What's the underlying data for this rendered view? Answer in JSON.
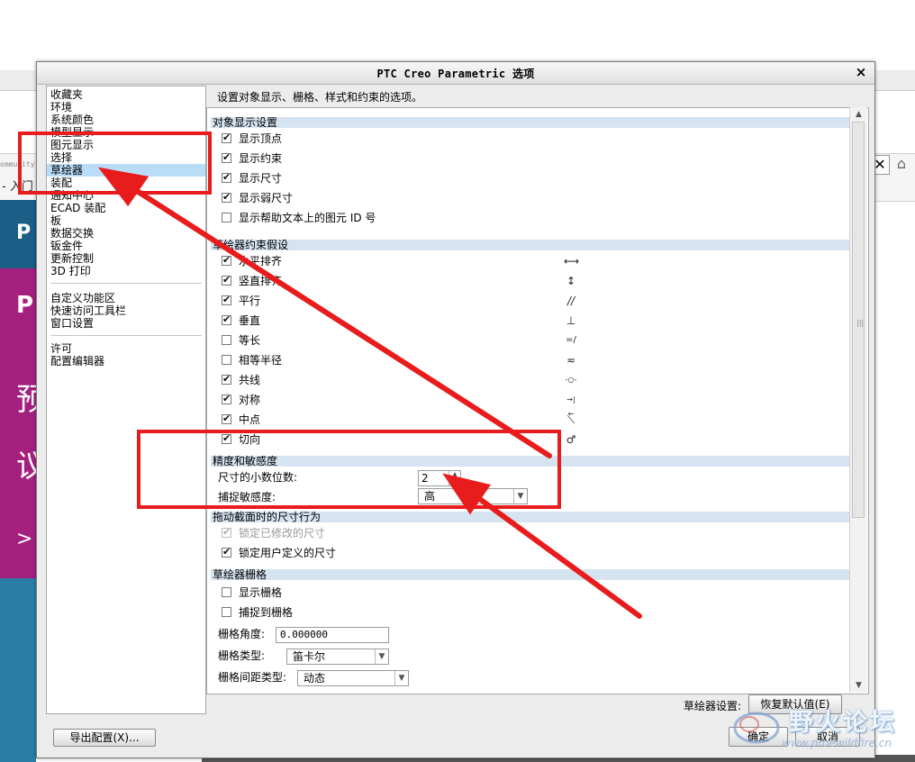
{
  "background": {
    "url_fragment": "ommunity",
    "breadcrumb": "- 入门",
    "banner_glyphs": [
      "P",
      "P",
      "预",
      "议",
      ">"
    ],
    "colors": {
      "banner": "#a4207f",
      "banner_top": "#1b5f86"
    }
  },
  "dialog": {
    "title": "PTC Creo Parametric 选项",
    "close_symbol": "×",
    "description": "设置对象显示、栅格、样式和约束的选项。",
    "nav": {
      "group1": [
        "收藏夹",
        "环境",
        "系统颜色",
        "模型显示",
        "图元显示",
        "选择",
        "草绘器",
        "装配",
        "通知中心",
        "ECAD 装配",
        "板",
        "数据交换",
        "钣金件",
        "更新控制",
        "3D 打印"
      ],
      "selected": "草绘器",
      "group2": [
        "自定义功能区",
        "快速访问工具栏",
        "窗口设置"
      ],
      "group3": [
        "许可",
        "配置编辑器"
      ]
    },
    "sections": {
      "object_display": {
        "title": "对象显示设置",
        "options": [
          {
            "label": "显示顶点",
            "checked": true
          },
          {
            "label": "显示约束",
            "checked": true
          },
          {
            "label": "显示尺寸",
            "checked": true
          },
          {
            "label": "显示弱尺寸",
            "checked": true
          },
          {
            "label": "显示帮助文本上的图元 ID 号",
            "checked": false
          }
        ]
      },
      "constraints": {
        "title": "草绘器约束假设",
        "options": [
          {
            "label": "水平排齐",
            "checked": true,
            "symbol": "⟷"
          },
          {
            "label": "竖直排齐",
            "checked": true,
            "symbol": "↕"
          },
          {
            "label": "平行",
            "checked": true,
            "symbol": "//"
          },
          {
            "label": "垂直",
            "checked": true,
            "symbol": "⊥"
          },
          {
            "label": "等长",
            "checked": false,
            "symbol": "=/"
          },
          {
            "label": "相等半径",
            "checked": false,
            "symbol": "≂"
          },
          {
            "label": "共线",
            "checked": true,
            "symbol": "-○-"
          },
          {
            "label": "对称",
            "checked": true,
            "symbol": "→|←"
          },
          {
            "label": "中点",
            "checked": true,
            "symbol": "⟍"
          },
          {
            "label": "切向",
            "checked": true,
            "symbol": "♂"
          }
        ]
      },
      "precision": {
        "title": "精度和敏感度",
        "decimal_label": "尺寸的小数位数:",
        "decimal_value": "2",
        "snap_label": "捕捉敏感度:",
        "snap_value": "高"
      },
      "drag": {
        "title": "拖动截面时的尺寸行为",
        "options": [
          {
            "label": "锁定已修改的尺寸",
            "checked": true,
            "disabled": true
          },
          {
            "label": "锁定用户定义的尺寸",
            "checked": true,
            "disabled": false
          }
        ]
      },
      "grid": {
        "title": "草绘器栅格",
        "options": [
          {
            "label": "显示栅格",
            "checked": false
          },
          {
            "label": "捕捉到栅格",
            "checked": false
          }
        ],
        "angle_label": "栅格角度:",
        "angle_value": "0.000000",
        "type_label": "栅格类型:",
        "type_value": "笛卡尔",
        "spacing_label": "栅格间距类型:",
        "spacing_value": "动态"
      }
    },
    "footer": {
      "sketcher_settings_label": "草绘器设置:",
      "restore_defaults": "恢复默认值(E)",
      "export_config": "导出配置(X)...",
      "ok": "确定",
      "cancel": "取消"
    },
    "scroll": {
      "up": "▲",
      "down": "▼",
      "grip": "|||"
    }
  },
  "watermark": {
    "text": "野火论坛",
    "url": "www.proewildfire.cn"
  },
  "annotation_color": "#e81c1c"
}
